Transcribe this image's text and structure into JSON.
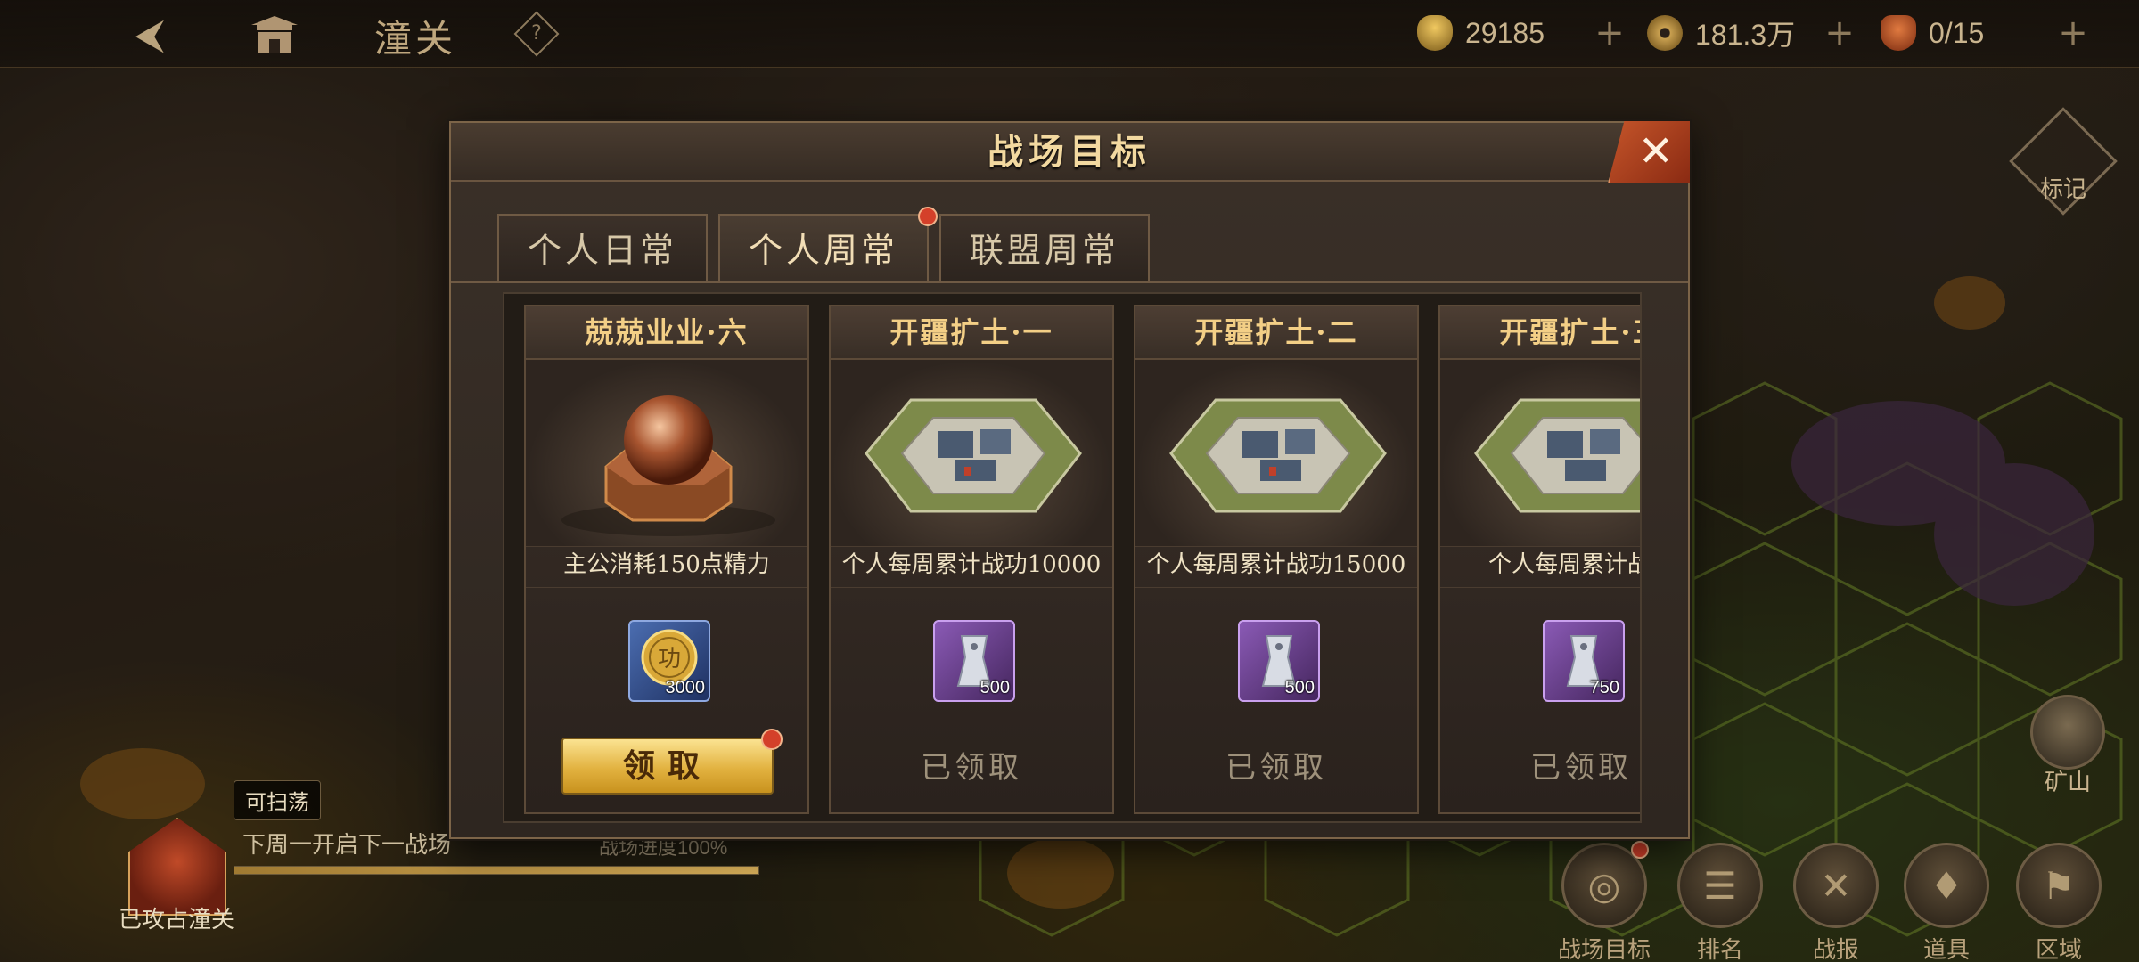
{
  "header": {
    "location": "潼关",
    "back_icon": "back-arrow-icon",
    "pass_icon": "gate-icon",
    "help": "?"
  },
  "resources": [
    {
      "name": "ingot",
      "value": "29185",
      "icon": "gold-ingot-icon",
      "color": "#c9a040"
    },
    {
      "name": "coin",
      "value": "181.3万",
      "icon": "copper-coin-icon",
      "color": "#b08a3a"
    },
    {
      "name": "food",
      "value": "0/15",
      "icon": "food-icon",
      "color": "#b5532c"
    }
  ],
  "right_panel": {
    "mark_label": "标记",
    "mine_label": "矿山"
  },
  "bottom_left": {
    "sweep_tag": "可扫荡",
    "next_battle": "下周一开启下一战场",
    "progress_label": "战场进度100%",
    "progress": 1.0,
    "occupied_label": "已攻占潼关"
  },
  "bottom_buttons": [
    {
      "label": "战场目标",
      "icon": "target-icon",
      "glyph": "◎",
      "badge": true
    },
    {
      "label": "排名",
      "icon": "scroll-icon",
      "glyph": "☰",
      "badge": false
    },
    {
      "label": "战报",
      "icon": "battle-report-icon",
      "glyph": "✕",
      "badge": false
    },
    {
      "label": "道具",
      "icon": "bag-icon",
      "glyph": "♦",
      "badge": false
    },
    {
      "label": "区域",
      "icon": "flag-icon",
      "glyph": "⚑",
      "badge": false
    }
  ],
  "dialog": {
    "title": "战场目标",
    "close_icon": "close-icon",
    "close_glyph": "✕",
    "tabs": [
      {
        "label": "个人日常",
        "active": false,
        "badge": false
      },
      {
        "label": "个人周常",
        "active": true,
        "badge": true
      },
      {
        "label": "联盟周常",
        "active": false,
        "badge": false
      }
    ],
    "cards": [
      {
        "title": "兢兢业业·六",
        "art": "energy-orb",
        "desc": "主公消耗150点精力",
        "reward_icon": "merit-coin-icon",
        "reward_qty": "3000",
        "reward_tier": "blue",
        "status": "claim",
        "claim_label": "领取"
      },
      {
        "title": "开疆扩土·一",
        "art": "fortress",
        "desc": "个人每周累计战功10000",
        "reward_icon": "silver-token-icon",
        "reward_qty": "500",
        "reward_tier": "purple",
        "status": "claimed",
        "claimed_label": "已领取"
      },
      {
        "title": "开疆扩土·二",
        "art": "fortress",
        "desc": "个人每周累计战功15000",
        "reward_icon": "silver-token-icon",
        "reward_qty": "500",
        "reward_tier": "purple",
        "status": "claimed",
        "claimed_label": "已领取"
      },
      {
        "title": "开疆扩土·三",
        "art": "fortress",
        "desc": "个人每周累计战功",
        "reward_icon": "silver-token-icon",
        "reward_qty": "750",
        "reward_tier": "purple",
        "status": "claimed",
        "claimed_label": "已领取"
      }
    ]
  }
}
